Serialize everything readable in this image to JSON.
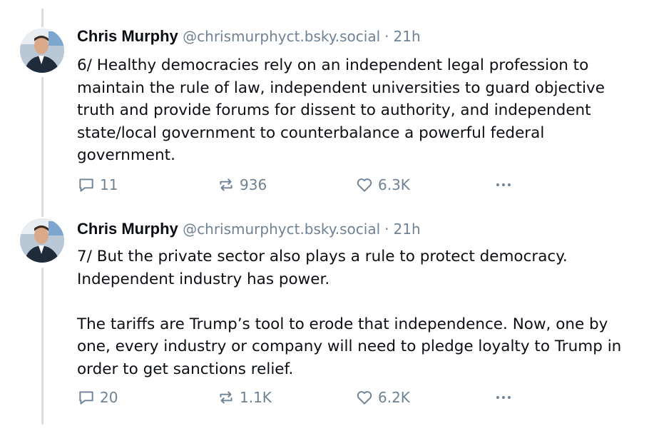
{
  "posts": [
    {
      "author_name": "Chris Murphy",
      "handle": "@chrismurphyct.bsky.social",
      "separator": "·",
      "time": "21h",
      "text": "6/ Healthy democracies rely on an independent legal profession to maintain the rule of law, independent universities to guard objective truth and provide forums for dissent to authority, and independent state/local government to counterbalance a powerful federal government.",
      "replies": "11",
      "reposts": "936",
      "likes": "6.3K"
    },
    {
      "author_name": "Chris Murphy",
      "handle": "@chrismurphyct.bsky.social",
      "separator": "·",
      "time": "21h",
      "text": "7/ But the private sector also plays a rule to protect democracy. Independent industry has power.\n\nThe tariffs are Trump’s tool to erode that independence. Now, one by one, every industry or company will need to pledge loyalty to Trump in order to get sanctions relief.",
      "replies": "20",
      "reposts": "1.1K",
      "likes": "6.2K"
    }
  ],
  "icons": {
    "reply": "speech-bubble-icon",
    "repost": "repost-arrows-icon",
    "like": "heart-icon",
    "more": "ellipsis-icon"
  },
  "colors": {
    "text": "#0b0f14",
    "muted": "#6f8294",
    "thread_line": "#d7dde3"
  }
}
